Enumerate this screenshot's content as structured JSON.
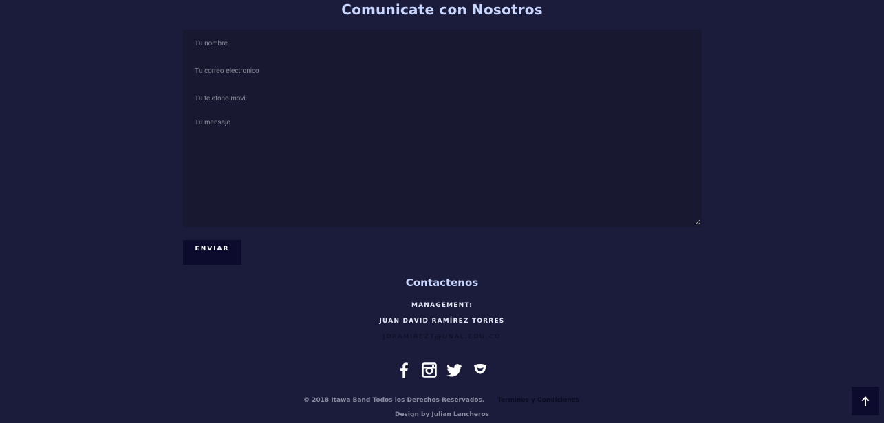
{
  "page": {
    "title": "Comunicate con Nosotros"
  },
  "form": {
    "name_placeholder": "Tu nombre",
    "email_placeholder": "Tu correo electronico",
    "phone_placeholder": "Tu telefono movil",
    "message_placeholder": "Tu mensaje",
    "send_label": "ENVIAR"
  },
  "contact": {
    "title": "Contactenos",
    "role": "MANAGEMENT:",
    "name": "JUAN DAVID RAMÍREZ TORRES",
    "email": "JDRAMIREZT@UNAL.EDU.CO"
  },
  "socials": [
    {
      "icon": "facebook-icon"
    },
    {
      "icon": "instagram-icon"
    },
    {
      "icon": "twitter-icon"
    },
    {
      "icon": "itawa-logo-icon"
    }
  ],
  "footer": {
    "copyright": "© 2018 Itawa Band Todos los Derechos Reservados.",
    "terms": "Terminos y Condiciones",
    "credit": "Design by Julian Lancheros"
  },
  "colors": {
    "background": "#1b1c3b",
    "form_background": "#181930",
    "button": "#0c0b2e",
    "title": "#c9d6ff"
  }
}
